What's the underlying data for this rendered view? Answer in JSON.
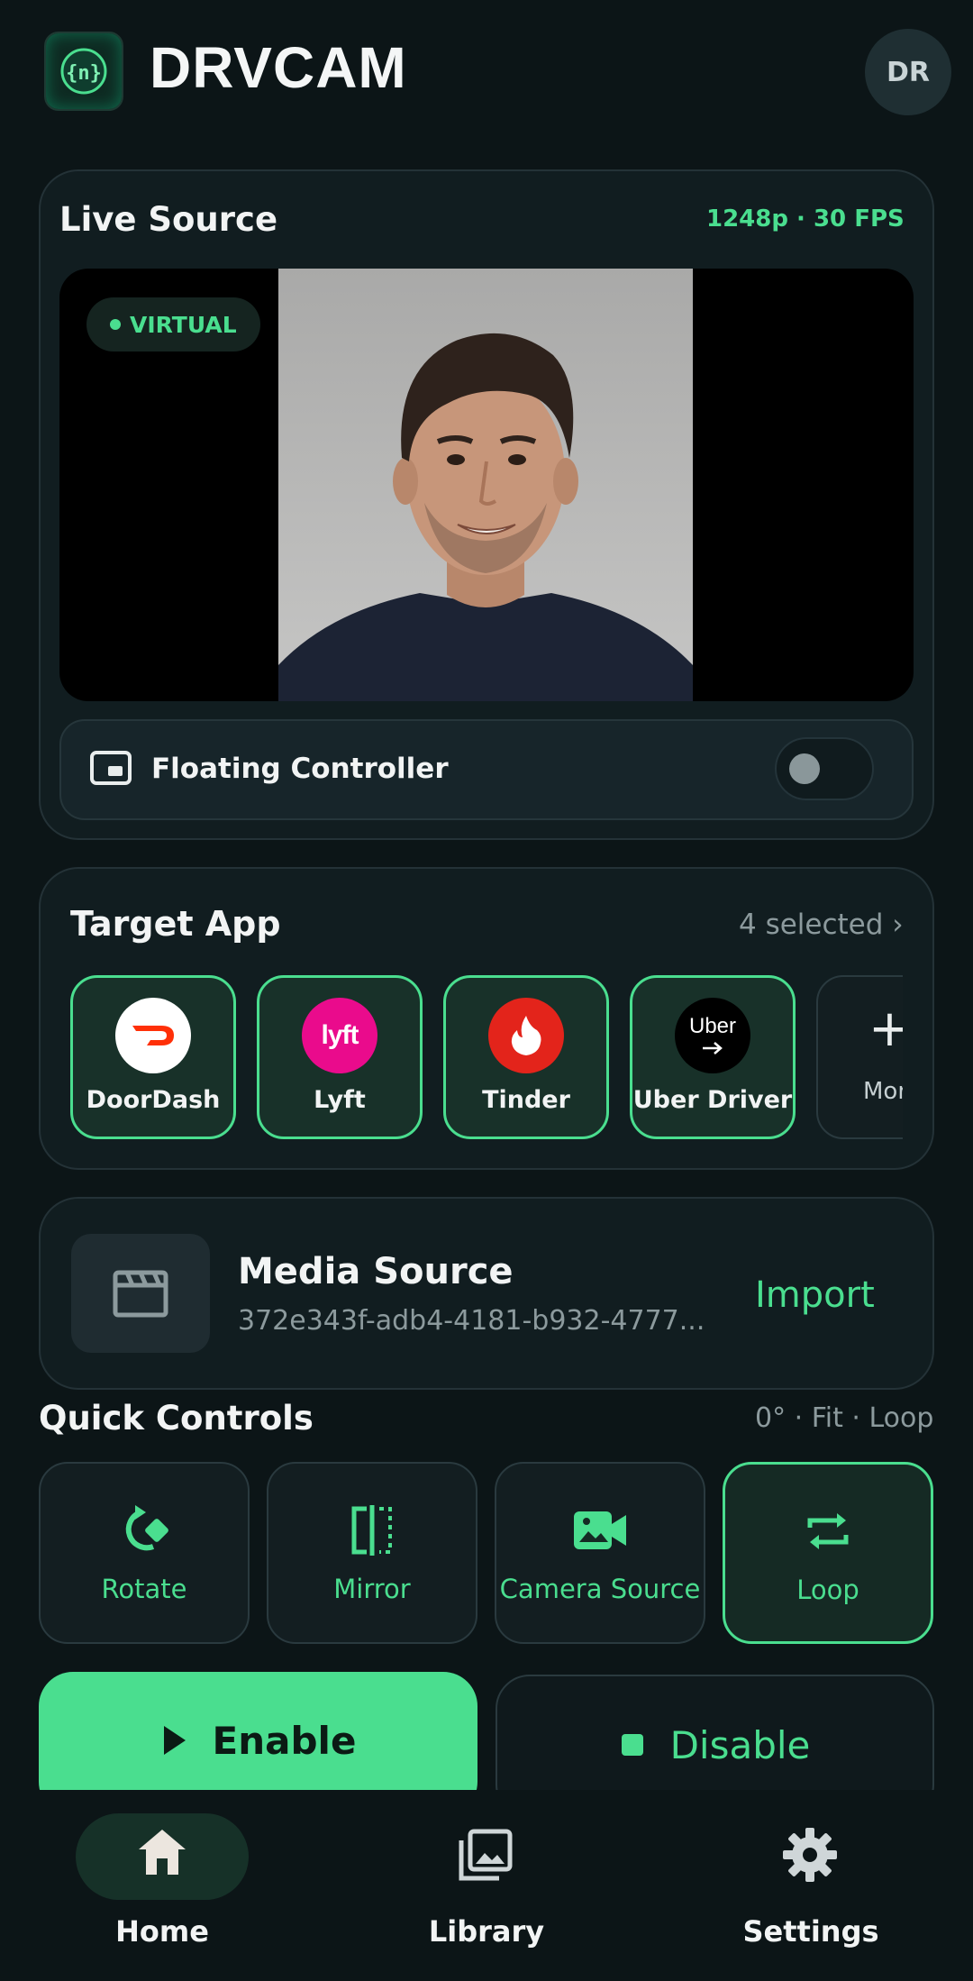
{
  "header": {
    "app_name": "DRVCAM",
    "avatar_initials": "DR",
    "logo_icon": "braces-icon"
  },
  "live_source": {
    "title": "Live Source",
    "meta": "1248p · 30 FPS",
    "badge": "VIRTUAL",
    "floating_controller_label": "Floating Controller",
    "floating_controller_enabled": false
  },
  "target_app": {
    "title": "Target App",
    "selected_text": "4 selected ›",
    "apps": [
      {
        "name": "DoorDash",
        "logo_text": ""
      },
      {
        "name": "Lyft",
        "logo_text": "lyft"
      },
      {
        "name": "Tinder",
        "logo_text": ""
      },
      {
        "name": "Uber Driver",
        "logo_text": "Uber"
      }
    ],
    "more_label": "More"
  },
  "media_source": {
    "title": "Media Source",
    "id": "372e343f-adb4-4181-b932-4777...",
    "import_label": "Import"
  },
  "quick_controls": {
    "title": "Quick Controls",
    "meta": "0° · Fit · Loop",
    "items": [
      {
        "label": "Rotate",
        "icon": "rotate-icon",
        "active": false
      },
      {
        "label": "Mirror",
        "icon": "mirror-icon",
        "active": false
      },
      {
        "label": "Camera Source",
        "icon": "camera-icon",
        "active": false
      },
      {
        "label": "Loop",
        "icon": "loop-icon",
        "active": true
      }
    ]
  },
  "actions": {
    "enable_label": "Enable",
    "disable_label": "Disable"
  },
  "nav": {
    "items": [
      {
        "label": "Home",
        "icon": "home-icon",
        "active": true
      },
      {
        "label": "Library",
        "icon": "library-icon",
        "active": false
      },
      {
        "label": "Settings",
        "icon": "gear-icon",
        "active": false
      }
    ]
  },
  "colors": {
    "accent": "#4ade8f",
    "background": "#0c1517",
    "card": "#111d20"
  }
}
